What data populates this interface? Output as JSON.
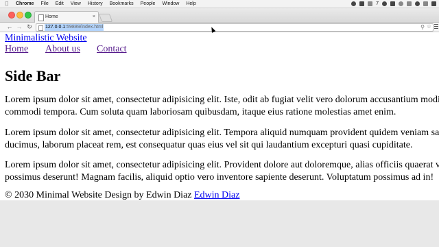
{
  "os_menubar": {
    "apple": "",
    "items": [
      "Chrome",
      "File",
      "Edit",
      "View",
      "History",
      "Bookmarks",
      "People",
      "Window",
      "Help"
    ],
    "status_text": "7"
  },
  "browser": {
    "tab_title": "Home",
    "tab_close": "×",
    "url_host": "127.0.0.1",
    "url_rest": ":59889/index.html"
  },
  "page": {
    "site_title": "Minimalistic Website",
    "nav": [
      "Home",
      "About us",
      "Contact"
    ],
    "heading": "Side Bar",
    "paragraphs": [
      [
        "Lorem ipsum dolor sit amet, consectetur adipisicing elit. Iste, odit ab fugiat velit vero dolorum accusantium modi",
        "commodi tempora. Cum soluta quam laboriosam quibusdam, itaque eius ratione molestias amet enim."
      ],
      [
        "Lorem ipsum dolor sit amet, consectetur adipisicing elit. Tempora aliquid numquam provident quidem veniam sa",
        "ducimus, laborum placeat rem, est consequatur quas eius vel sit qui laudantium excepturi quasi cupiditate."
      ],
      [
        "Lorem ipsum dolor sit amet, consectetur adipisicing elit. Provident dolore aut doloremque, alias officiis quaerat v",
        "possimus deserunt! Magnam facilis, aliquid optio vero inventore sapiente deserunt. Voluptatum possimus ad in!"
      ]
    ],
    "footer_text": "© 2030 Minimal Website   Design by Edwin Diaz",
    "footer_link": "Edwin Diaz"
  }
}
